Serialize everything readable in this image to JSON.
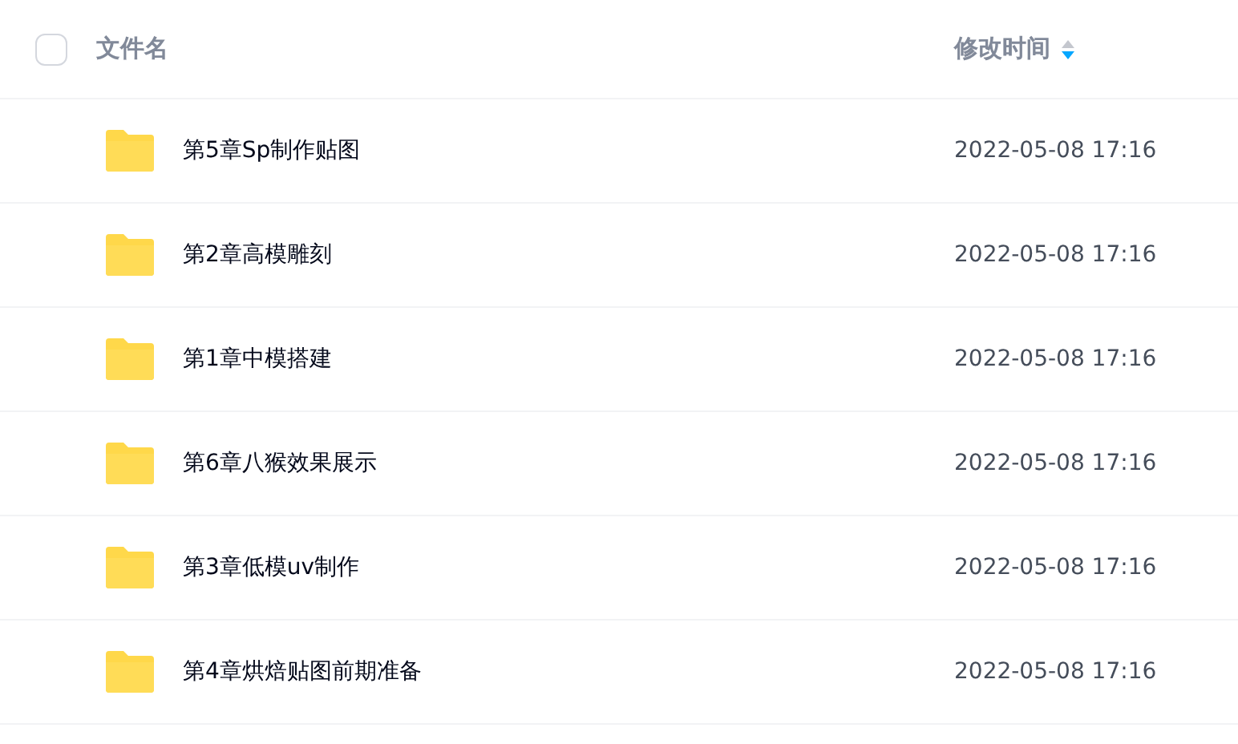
{
  "header": {
    "select_all": {
      "checked": false
    },
    "name_column": "文件名",
    "time_column": "修改时间",
    "sort_descending": true
  },
  "rows": [
    {
      "name": "第5章Sp制作贴图",
      "modified": "2022-05-08 17:16"
    },
    {
      "name": "第2章高模雕刻",
      "modified": "2022-05-08 17:16"
    },
    {
      "name": "第1章中模搭建",
      "modified": "2022-05-08 17:16"
    },
    {
      "name": "第6章八猴效果展示",
      "modified": "2022-05-08 17:16"
    },
    {
      "name": "第3章低模uv制作",
      "modified": "2022-05-08 17:16"
    },
    {
      "name": "第4章烘焙贴图前期准备",
      "modified": "2022-05-08 17:16"
    }
  ]
}
